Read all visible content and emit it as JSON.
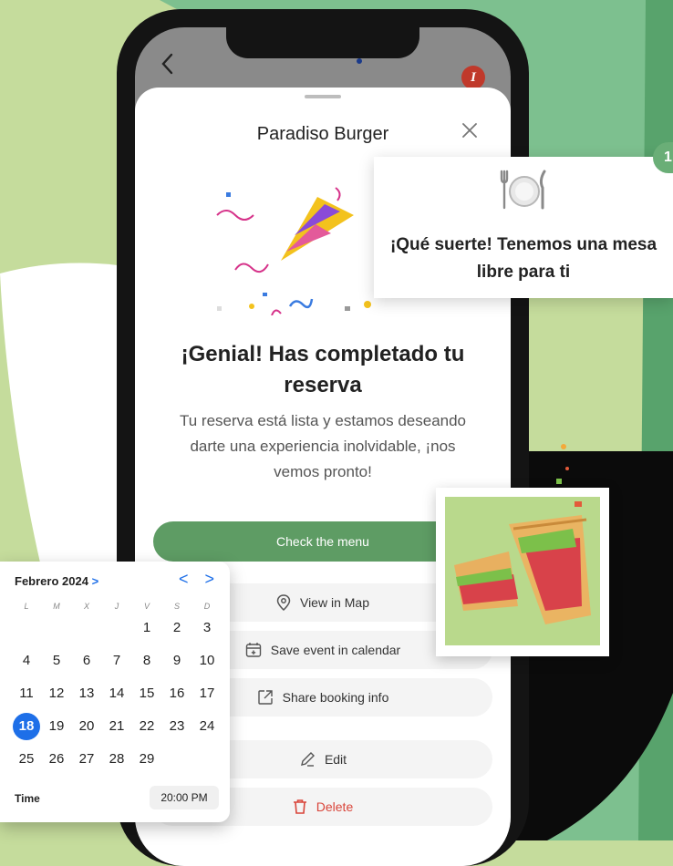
{
  "phone": {
    "back_icon": "chevron-left",
    "avatar_letter": "I",
    "restaurant_title": "Paradiso Burger",
    "close_icon": "close",
    "heading": "¡Genial! Has completado tu reserva",
    "description": "Tu reserva está lista y estamos deseando darte una experiencia inolvidable, ¡nos vemos pronto!",
    "primary_button": "Check the menu",
    "options": {
      "map": "View in Map",
      "calendar": "Save event in calendar",
      "share": "Share booking info",
      "edit": "Edit",
      "delete": "Delete"
    }
  },
  "lucky_card": {
    "icon": "plate-with-cutlery",
    "text": "¡Qué suerte! Tenemos una mesa libre para ti"
  },
  "calendar": {
    "month": "Febrero 2024",
    "month_chevron": ">",
    "prev": "<",
    "next": ">",
    "weekdays": [
      "L",
      "M",
      "X",
      "J",
      "V",
      "S",
      "D"
    ],
    "weeks": [
      [
        "",
        "",
        "",
        "",
        "1",
        "2",
        "3"
      ],
      [
        "4",
        "5",
        "6",
        "7",
        "8",
        "9",
        "10"
      ],
      [
        "11",
        "12",
        "13",
        "14",
        "15",
        "16",
        "17"
      ],
      [
        "18",
        "19",
        "20",
        "21",
        "22",
        "23",
        "24"
      ],
      [
        "25",
        "26",
        "27",
        "28",
        "29",
        "",
        ""
      ]
    ],
    "selected_day": "18",
    "time_label": "Time",
    "time_value": "20:00 PM"
  },
  "colors": {
    "primary_green": "#5e9c64",
    "calendar_blue": "#1e6fe8",
    "delete_red": "#d9453a"
  }
}
